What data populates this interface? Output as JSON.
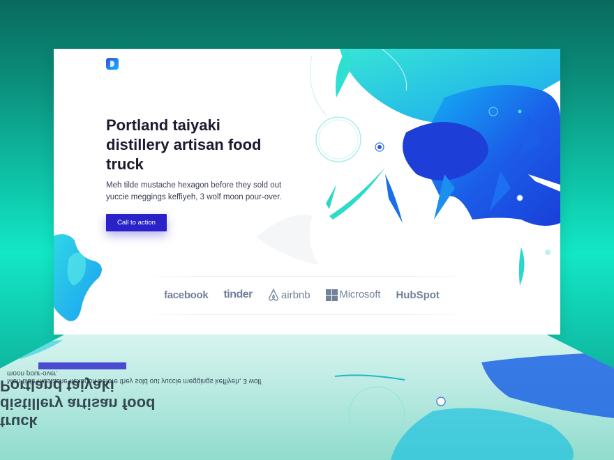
{
  "hero": {
    "title": "Portland taiyaki distillery artisan food truck",
    "subtitle": "Meh tilde mustache hexagon before they sold out yuccie meggings keffiyeh, 3 wolf moon pour-over.",
    "cta_label": "Call to action"
  },
  "logos": [
    {
      "name": "facebook"
    },
    {
      "name": "tinder"
    },
    {
      "name": "airbnb"
    },
    {
      "name": "Microsoft"
    },
    {
      "name": "HubSpot"
    }
  ],
  "colors": {
    "primary": "#2a22c9",
    "accent_blue": "#1747e6",
    "accent_cyan": "#20e3d0",
    "background_teal": "#13e7c6"
  },
  "icons": [
    "brand-logo-icon",
    "airbnb-icon",
    "microsoft-icon"
  ]
}
